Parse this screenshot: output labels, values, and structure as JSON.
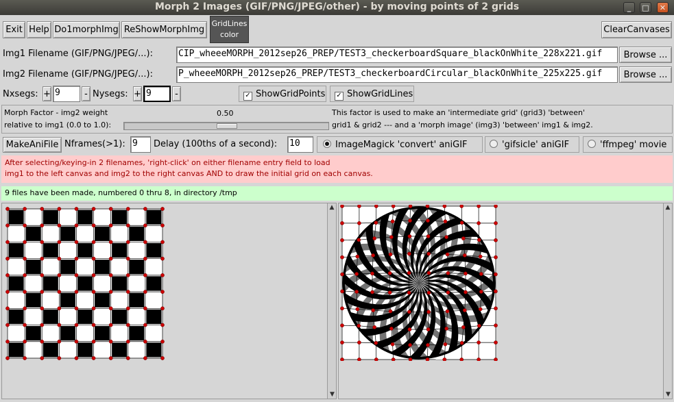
{
  "window": {
    "title": "Morph 2 Images (GIF/PNG/JPEG/other) - by moving points of 2 grids",
    "minimize": "_",
    "maximize": "□",
    "close": "✕"
  },
  "toolbar": {
    "exit": "Exit",
    "help": "Help",
    "do_morph": "Do1morphImg",
    "reshow": "ReShowMorphImg",
    "gridlines_color_1": "GridLines",
    "gridlines_color_2": "color",
    "clear": "ClearCanvases"
  },
  "files": {
    "img1_label": "Img1 Filename (GIF/PNG/JPEG/...):",
    "img1_value": "CIP_wheeeMORPH_2012sep26_PREP/TEST3_checkerboardSquare_blackOnWhite_228x221.gif",
    "img2_label": "Img2 Filename (GIF/PNG/JPEG/...):",
    "img2_value": "P_wheeeMORPH_2012sep26_PREP/TEST3_checkerboardCircular_blackOnWhite_225x225.gif",
    "browse": "Browse ..."
  },
  "grid": {
    "nx_label": "Nxsegs:",
    "nx_value": "9",
    "ny_label": "Nysegs:",
    "ny_value": "9",
    "plus": "+",
    "minus": "-",
    "show_points": "ShowGridPoints",
    "show_lines": "ShowGridLines",
    "check": "✓"
  },
  "morph": {
    "label1": "Morph Factor - img2 weight",
    "label2": "relative to img1 (0.0 to 1.0):",
    "value": "0.50",
    "factor": 0.5,
    "desc1": "This factor is used to make an 'intermediate grid' (grid3) 'between'",
    "desc2": "grid1 & grid2 --- and a 'morph image' (img3) 'between' img1 & img2."
  },
  "anim": {
    "make": "MakeAniFile",
    "nframes_label": "Nframes(>1):",
    "nframes_value": "9",
    "delay_label": "Delay (100ths of a second):",
    "delay_value": "10",
    "opt_convert": "ImageMagick 'convert' aniGIF",
    "opt_gifsicle": "'gifsicle' aniGIF",
    "opt_ffmpeg": "'ffmpeg' movie"
  },
  "messages": {
    "info1": "After selecting/keying-in 2 filenames, 'right-click' on either filename entry field to load",
    "info2": "img1 to the left canvas and img2 to the right canvas AND to draw the initial grid on each canvas.",
    "status": "9 files have been made, numbered 0 thru 8,  in directory /tmp"
  },
  "colors": {
    "info_bg": "#ffcccc",
    "info_fg": "#a00000",
    "status_bg": "#ccffcc",
    "grid_point": "#cc0000",
    "gridlines_btn": "#555555"
  }
}
